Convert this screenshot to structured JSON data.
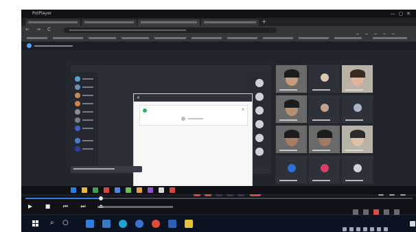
{
  "player": {
    "app_name": "PotPlayer",
    "window_controls_icon": "window-controls-icon"
  },
  "browser": {
    "new_tab_glyph": "+",
    "nav_glyphs": "← → C"
  },
  "meeting": {
    "dialog": {
      "title": "",
      "close_glyph": "×",
      "card_title": "",
      "card_close_glyph": "×"
    }
  },
  "player_controls": {
    "button_glyphs": "▶ ■ ⏮ ⏭ ⏏",
    "time_text": ""
  },
  "host_taskbar": {
    "search_glyph": "⌕",
    "taskview_glyph": "○",
    "clock_time": "",
    "clock_date": ""
  },
  "colors": {
    "meeting_background": "#23252d",
    "accent_blue": "#2f7fe0",
    "record_red": "#d64b43",
    "taskbar": "#0c1320"
  }
}
